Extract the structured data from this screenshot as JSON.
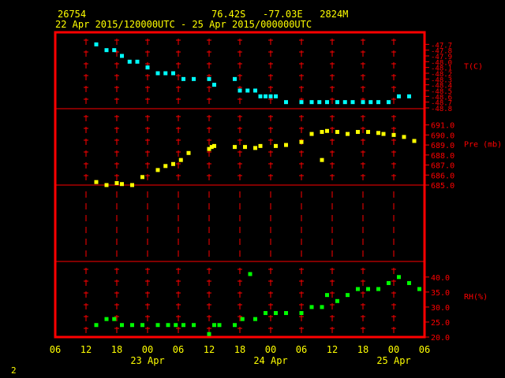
{
  "header": {
    "station": "26754",
    "location": "76.42S   -77.03E   2824M",
    "period": "22 Apr 2015/120000UTC - 25 Apr 2015/000000UTC"
  },
  "corner_label": "2",
  "colors": {
    "frame": "#ff0000",
    "text": "#ffff00",
    "grid_line": "#ff0000",
    "temperature": "#00ffff",
    "pressure": "#ffff00",
    "humidity": "#00ff00"
  },
  "chart_data": {
    "type": "scatter",
    "grid": true,
    "x_axis": {
      "tick_labels": [
        "06",
        "12",
        "18",
        "00",
        "06",
        "12",
        "18",
        "00",
        "06",
        "12",
        "18",
        "00",
        "06"
      ],
      "date_labels": [
        {
          "label": "23 Apr",
          "hour": 18
        },
        {
          "label": "24 Apr",
          "hour": 42
        },
        {
          "label": "25 Apr",
          "hour": 66
        }
      ],
      "range_hours": [
        0,
        72
      ]
    },
    "panels": [
      {
        "name": "T(C)",
        "series": "temperature",
        "ylim": [
          -48.8,
          -47.6
        ],
        "ticks": [
          "-47.7",
          "-47.8",
          "-47.9",
          "-48.0",
          "-48.1",
          "-48.2",
          "-48.3",
          "-48.4",
          "-48.5",
          "-48.6",
          "-48.7",
          "-48.8"
        ],
        "tick_values": [
          -47.7,
          -47.8,
          -47.9,
          -48.0,
          -48.1,
          -48.2,
          -48.3,
          -48.4,
          -48.5,
          -48.6,
          -48.7,
          -48.8
        ],
        "points": [
          [
            8,
            -47.7
          ],
          [
            10,
            -47.8
          ],
          [
            11.5,
            -47.8
          ],
          [
            13,
            -47.9
          ],
          [
            14.5,
            -48.0
          ],
          [
            16,
            -48.0
          ],
          [
            18,
            -48.1
          ],
          [
            20,
            -48.2
          ],
          [
            21.5,
            -48.2
          ],
          [
            23,
            -48.2
          ],
          [
            25,
            -48.3
          ],
          [
            27,
            -48.3
          ],
          [
            30,
            -48.3
          ],
          [
            31,
            -48.4
          ],
          [
            35,
            -48.3
          ],
          [
            36,
            -48.5
          ],
          [
            37.5,
            -48.5
          ],
          [
            39,
            -48.5
          ],
          [
            40,
            -48.6
          ],
          [
            41,
            -48.6
          ],
          [
            42,
            -48.6
          ],
          [
            43,
            -48.6
          ],
          [
            45,
            -48.7
          ],
          [
            48,
            -48.7
          ],
          [
            50,
            -48.7
          ],
          [
            51.5,
            -48.7
          ],
          [
            53,
            -48.7
          ],
          [
            55,
            -48.7
          ],
          [
            56.5,
            -48.7
          ],
          [
            58,
            -48.7
          ],
          [
            60,
            -48.7
          ],
          [
            61.5,
            -48.7
          ],
          [
            63,
            -48.7
          ],
          [
            65,
            -48.7
          ],
          [
            67,
            -48.6
          ],
          [
            69,
            -48.6
          ]
        ]
      },
      {
        "name": "Pre (mb)",
        "series": "pressure",
        "ylim": [
          685,
          691.6
        ],
        "ticks": [
          "691.0",
          "690.0",
          "689.0",
          "688.0",
          "687.0",
          "686.0",
          "685.0"
        ],
        "tick_values": [
          691,
          690,
          689,
          688,
          687,
          686,
          685
        ],
        "points": [
          [
            8,
            685.3
          ],
          [
            10,
            685.0
          ],
          [
            12,
            685.2
          ],
          [
            13,
            685.1
          ],
          [
            15,
            685.0
          ],
          [
            17,
            685.8
          ],
          [
            20,
            686.5
          ],
          [
            21.5,
            686.9
          ],
          [
            23,
            687.1
          ],
          [
            24.5,
            687.5
          ],
          [
            26,
            688.2
          ],
          [
            30,
            688.6
          ],
          [
            30.5,
            688.8
          ],
          [
            31,
            688.9
          ],
          [
            35,
            688.8
          ],
          [
            37,
            688.8
          ],
          [
            39,
            688.7
          ],
          [
            40,
            688.9
          ],
          [
            43,
            688.9
          ],
          [
            45,
            689.0
          ],
          [
            48,
            689.3
          ],
          [
            50,
            690.1
          ],
          [
            52,
            690.3
          ],
          [
            53,
            690.4
          ],
          [
            52,
            687.5
          ],
          [
            55,
            690.3
          ],
          [
            57,
            690.1
          ],
          [
            59,
            690.3
          ],
          [
            61,
            690.3
          ],
          [
            63,
            690.2
          ],
          [
            64,
            690.1
          ],
          [
            66,
            690.0
          ],
          [
            68,
            689.8
          ],
          [
            70,
            689.4
          ]
        ]
      },
      {
        "name": "",
        "series": "empty",
        "ylim": [
          0,
          1
        ],
        "ticks": [],
        "tick_values": [],
        "points": []
      },
      {
        "name": "RH(%)",
        "series": "humidity",
        "ylim": [
          20,
          41
        ],
        "ticks": [
          "40.0",
          "35.0",
          "30.0",
          "25.0",
          "20.0"
        ],
        "tick_values": [
          40,
          35,
          30,
          25,
          20
        ],
        "points": [
          [
            8,
            24
          ],
          [
            10,
            26
          ],
          [
            11.5,
            26
          ],
          [
            13,
            24
          ],
          [
            15,
            24
          ],
          [
            17,
            24
          ],
          [
            20,
            24
          ],
          [
            22,
            24
          ],
          [
            23.5,
            24
          ],
          [
            25,
            24
          ],
          [
            27,
            24
          ],
          [
            30,
            21
          ],
          [
            31,
            24
          ],
          [
            32,
            24
          ],
          [
            35,
            24
          ],
          [
            36.5,
            26
          ],
          [
            38,
            41
          ],
          [
            39,
            26
          ],
          [
            41,
            28
          ],
          [
            43,
            28
          ],
          [
            45,
            28
          ],
          [
            48,
            28
          ],
          [
            50,
            30
          ],
          [
            52,
            30
          ],
          [
            53,
            34
          ],
          [
            55,
            32
          ],
          [
            57,
            34
          ],
          [
            59,
            36
          ],
          [
            61,
            36
          ],
          [
            63,
            36
          ],
          [
            65,
            38
          ],
          [
            67,
            40
          ],
          [
            69,
            38
          ],
          [
            71,
            36
          ]
        ]
      }
    ]
  }
}
